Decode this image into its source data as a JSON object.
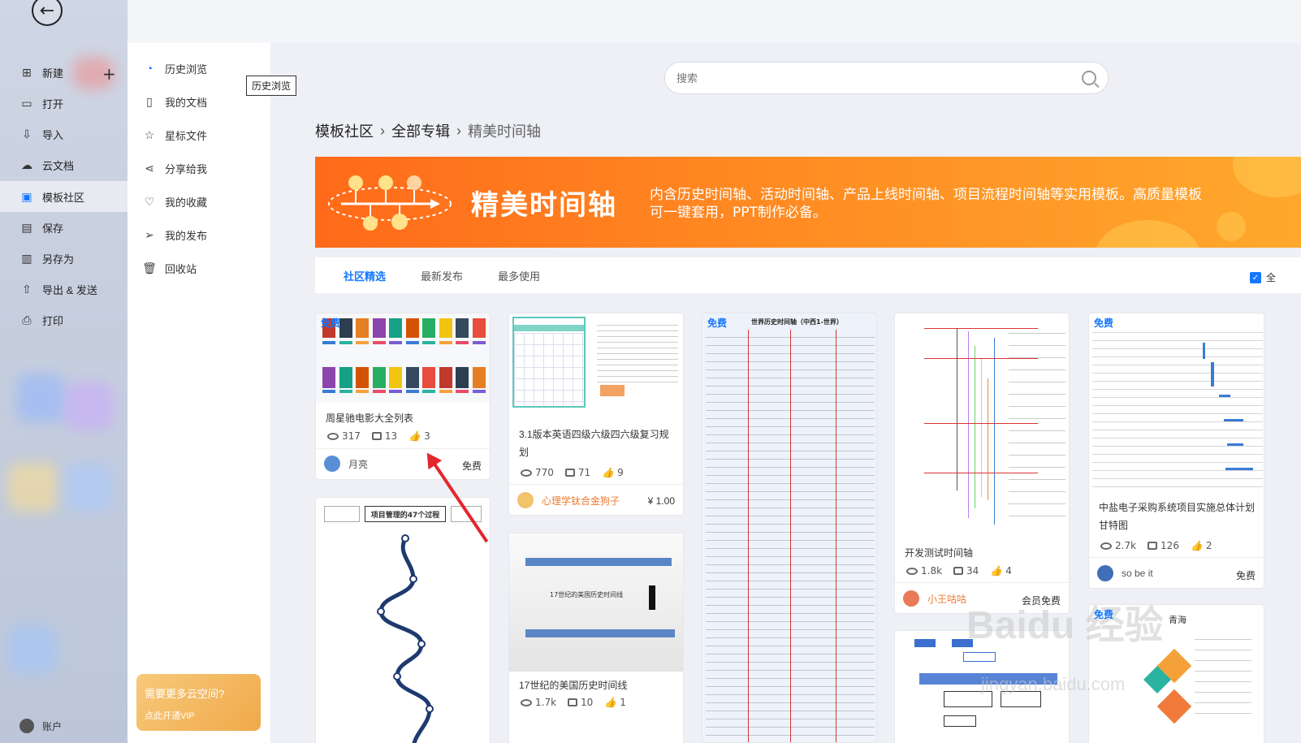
{
  "rail": {
    "items": [
      {
        "label": "新建",
        "icon": "plus-square-icon"
      },
      {
        "label": "打开",
        "icon": "folder-icon"
      },
      {
        "label": "导入",
        "icon": "import-icon"
      },
      {
        "label": "云文档",
        "icon": "cloud-icon"
      },
      {
        "label": "模板社区",
        "icon": "template-icon"
      },
      {
        "label": "保存",
        "icon": "save-icon"
      },
      {
        "label": "另存为",
        "icon": "save-as-icon"
      },
      {
        "label": "导出 & 发送",
        "icon": "export-icon"
      },
      {
        "label": "打印",
        "icon": "print-icon"
      }
    ],
    "account_label": "账户"
  },
  "sidebar": {
    "items": [
      {
        "label": "历史浏览",
        "icon": "clock-icon"
      },
      {
        "label": "我的文档",
        "icon": "document-icon"
      },
      {
        "label": "星标文件",
        "icon": "star-icon"
      },
      {
        "label": "分享给我",
        "icon": "share-icon"
      },
      {
        "label": "我的收藏",
        "icon": "heart-icon"
      },
      {
        "label": "我的发布",
        "icon": "send-icon"
      },
      {
        "label": "回收站",
        "icon": "trash-icon"
      }
    ],
    "tooltip": "历史浏览",
    "vip": {
      "line1": "需要更多云空间?",
      "line2": "点此开通VIP"
    }
  },
  "search": {
    "placeholder": "搜索"
  },
  "breadcrumb": {
    "root": "模板社区",
    "mid": "全部专辑",
    "current": "精美时间轴"
  },
  "banner": {
    "title": "精美时间轴",
    "description": "内含历史时间轴、活动时间轴、产品上线时间轴、项目流程时间轴等实用模板。高质量模板可一键套用，PPT制作必备。"
  },
  "tabs": [
    "社区精选",
    "最新发布",
    "最多使用"
  ],
  "checkbox_label": "全",
  "cards": {
    "c1": {
      "tag": "免费",
      "title": "周星驰电影大全列表",
      "views": "317",
      "comments": "13",
      "likes": "3",
      "author": "月亮",
      "price": "免费"
    },
    "c2": {
      "title": "3.1版本英语四级六级四六级复习规划",
      "views": "770",
      "comments": "71",
      "likes": "9",
      "author": "心理学钛合金狗子",
      "price": "¥ 1.00"
    },
    "c3": {
      "tag": "免费",
      "thumb_title": "世界历史时间轴（中西1-世界）"
    },
    "c4": {
      "title": "开发测试时间轴",
      "views": "1.8k",
      "comments": "34",
      "likes": "4",
      "author": "小王咕咕",
      "price": "会员免费"
    },
    "c5": {
      "tag": "免费",
      "title": "中盐电子采购系统项目实施总体计划甘特图",
      "views": "2.7k",
      "comments": "126",
      "likes": "2",
      "author": "so be it",
      "price": "免费"
    },
    "c6": {
      "thumb_title": "项目管理的47个过程"
    },
    "c7": {
      "thumb_title": "17世纪的美国历史时间线",
      "title": "17世纪的美国历史时间线",
      "views": "1.7k",
      "comments": "10",
      "likes": "1"
    },
    "c9": {
      "tag": "免费",
      "thumb_title": "青海"
    }
  },
  "watermark": {
    "brand": "Baidu 经验",
    "url": "jingyan.baidu.com"
  },
  "colors": {
    "accent": "#1677ff",
    "banner_orange": "#ff6a1a",
    "annotation_red": "#e3262b"
  }
}
